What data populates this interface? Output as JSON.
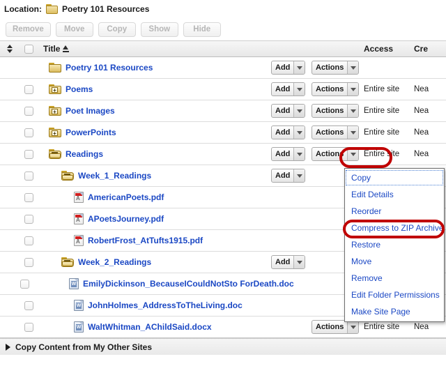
{
  "location": {
    "label": "Location:",
    "folder_icon": "folder-icon",
    "name": "Poetry 101 Resources"
  },
  "toolbar": {
    "buttons": [
      {
        "label": "Remove",
        "enabled": false
      },
      {
        "label": "Move",
        "enabled": false
      },
      {
        "label": "Copy",
        "enabled": false
      },
      {
        "label": "Show",
        "enabled": false
      },
      {
        "label": "Hide",
        "enabled": false
      }
    ]
  },
  "table": {
    "headers": {
      "sort": "sort-updown-icon",
      "checkbox": "select-all-checkbox",
      "title": "Title",
      "title_sort": "sort-ascending-icon",
      "access": "Access",
      "created": "Cre"
    },
    "add_label": "Add",
    "actions_label": "Actions",
    "rows": [
      {
        "title": "Poetry 101 Resources",
        "icon": "folder-icon",
        "indent": 1,
        "checkbox": false,
        "add": true,
        "actions": true,
        "access": "",
        "created": ""
      },
      {
        "title": "Poems",
        "icon": "folder-collapsed-icon",
        "indent": 1,
        "checkbox": true,
        "add": true,
        "actions": true,
        "access": "Entire site",
        "created": "Nea"
      },
      {
        "title": "Poet Images",
        "icon": "folder-collapsed-icon",
        "indent": 1,
        "checkbox": true,
        "add": true,
        "actions": true,
        "access": "Entire site",
        "created": "Nea"
      },
      {
        "title": "PowerPoints",
        "icon": "folder-collapsed-icon",
        "indent": 1,
        "checkbox": true,
        "add": true,
        "actions": true,
        "access": "Entire site",
        "created": "Nea"
      },
      {
        "title": "Readings",
        "icon": "folder-expanded-icon",
        "indent": 1,
        "checkbox": true,
        "add": true,
        "actions": true,
        "access": "Entire site",
        "created": "Nea",
        "highlighted_actions": true
      },
      {
        "title": "Week_1_Readings",
        "icon": "folder-expanded-icon",
        "indent": 2,
        "checkbox": true,
        "add": true,
        "actions": false,
        "access": "",
        "created": ""
      },
      {
        "title": "AmericanPoets.pdf",
        "icon": "pdf-file-icon",
        "indent": 3,
        "checkbox": true,
        "add": false,
        "actions": false,
        "access": "",
        "created": ""
      },
      {
        "title": "APoetsJourney.pdf",
        "icon": "pdf-file-icon",
        "indent": 3,
        "checkbox": true,
        "add": false,
        "actions": false,
        "access": "",
        "created": ""
      },
      {
        "title": "RobertFrost_AtTufts1915.pdf",
        "icon": "pdf-file-icon",
        "indent": 3,
        "checkbox": true,
        "add": false,
        "actions": false,
        "access": "",
        "created": ""
      },
      {
        "title": "Week_2_Readings",
        "icon": "folder-expanded-icon",
        "indent": 2,
        "checkbox": true,
        "add": true,
        "actions": false,
        "access": "",
        "created": ""
      },
      {
        "title": "EmilyDickinson_BecauseICouldNotSto ForDeath.doc",
        "icon": "word-file-icon",
        "indent": 3,
        "checkbox": true,
        "add": false,
        "actions": false,
        "access": "",
        "created": ""
      },
      {
        "title": "JohnHolmes_AddressToTheLiving.doc",
        "icon": "word-file-icon",
        "indent": 3,
        "checkbox": true,
        "add": false,
        "actions": false,
        "access": "",
        "created": ""
      },
      {
        "title": "WaltWhitman_AChildSaid.docx",
        "icon": "word-file-icon",
        "indent": 3,
        "checkbox": true,
        "add": false,
        "actions": true,
        "access": "Entire site",
        "created": "Nea"
      }
    ]
  },
  "actions_menu": {
    "open": true,
    "items": [
      {
        "label": "Copy",
        "focused": true
      },
      {
        "label": "Edit Details",
        "focused": false
      },
      {
        "label": "Reorder",
        "focused": false
      },
      {
        "label": "Compress to ZIP Archive",
        "focused": false,
        "highlighted": true
      },
      {
        "label": "Restore",
        "focused": false
      },
      {
        "label": "Move",
        "focused": false
      },
      {
        "label": "Remove",
        "focused": false
      },
      {
        "label": "Edit Folder Permissions",
        "focused": false
      },
      {
        "label": "Make Site Page",
        "focused": false
      }
    ]
  },
  "bottom": {
    "expander_icon": "triangle-right-icon",
    "label": "Copy Content from My Other Sites"
  },
  "colors": {
    "link": "#1b48c4",
    "highlight": "#c00000",
    "folder": "#dcbe61",
    "pdf": "#d21f1f"
  }
}
